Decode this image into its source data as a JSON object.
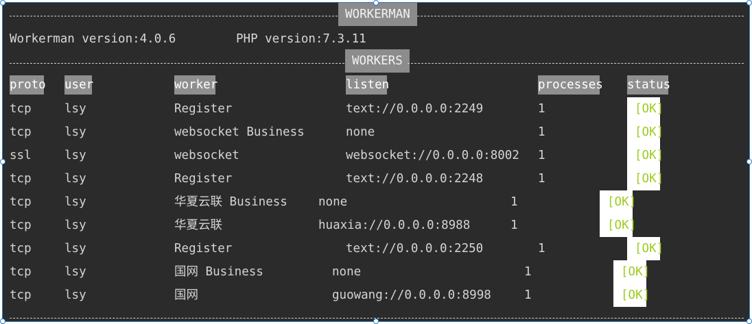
{
  "banner_top": "WORKERMAN",
  "banner_workers": "WORKERS",
  "version_line": {
    "workerman": "Workerman version:4.0.6",
    "php": "PHP version:7.3.11"
  },
  "headers": {
    "proto": "proto",
    "user": "user",
    "worker": "worker",
    "listen": "listen",
    "processes": "processes",
    "status": "status"
  },
  "rows": [
    {
      "proto": "tcp",
      "user": "lsy",
      "worker": "Register",
      "listen": "text://0.0.0.0:2249",
      "processes": "1",
      "status": "[OK]"
    },
    {
      "proto": "tcp",
      "user": "lsy",
      "worker": "websocket Business",
      "listen": "none",
      "processes": "1",
      "status": "[OK]"
    },
    {
      "proto": "ssl",
      "user": "lsy",
      "worker": "websocket",
      "listen": "websocket://0.0.0.0:8002",
      "processes": "1",
      "status": "[OK]"
    },
    {
      "proto": "tcp",
      "user": "lsy",
      "worker": "Register",
      "listen": "text://0.0.0.0:2248",
      "processes": "1",
      "status": "[OK]"
    },
    {
      "proto": "tcp",
      "user": "lsy",
      "worker": "华夏云联 Business",
      "listen": "none",
      "processes": "1",
      "status": "[OK]"
    },
    {
      "proto": "tcp",
      "user": "lsy",
      "worker": "华夏云联",
      "listen": "huaxia://0.0.0.0:8988",
      "processes": "1",
      "status": "[OK]"
    },
    {
      "proto": "tcp",
      "user": "lsy",
      "worker": "Register",
      "listen": "text://0.0.0.0:2250",
      "processes": "1",
      "status": "[OK]"
    },
    {
      "proto": "tcp",
      "user": "lsy",
      "worker": "国网 Business",
      "listen": "none",
      "processes": "1",
      "status": "[OK]"
    },
    {
      "proto": "tcp",
      "user": "lsy",
      "worker": "国网",
      "listen": "guowang://0.0.0.0:8998",
      "processes": "1",
      "status": "[OK]"
    }
  ],
  "colors": {
    "background": "#2b2b2b",
    "text": "#d4d4d4",
    "header_bg": "#8f8f8f",
    "ok_text": "#9ccc1f",
    "ok_bg": "#ffffff",
    "selection_border": "#2a7fc7"
  }
}
